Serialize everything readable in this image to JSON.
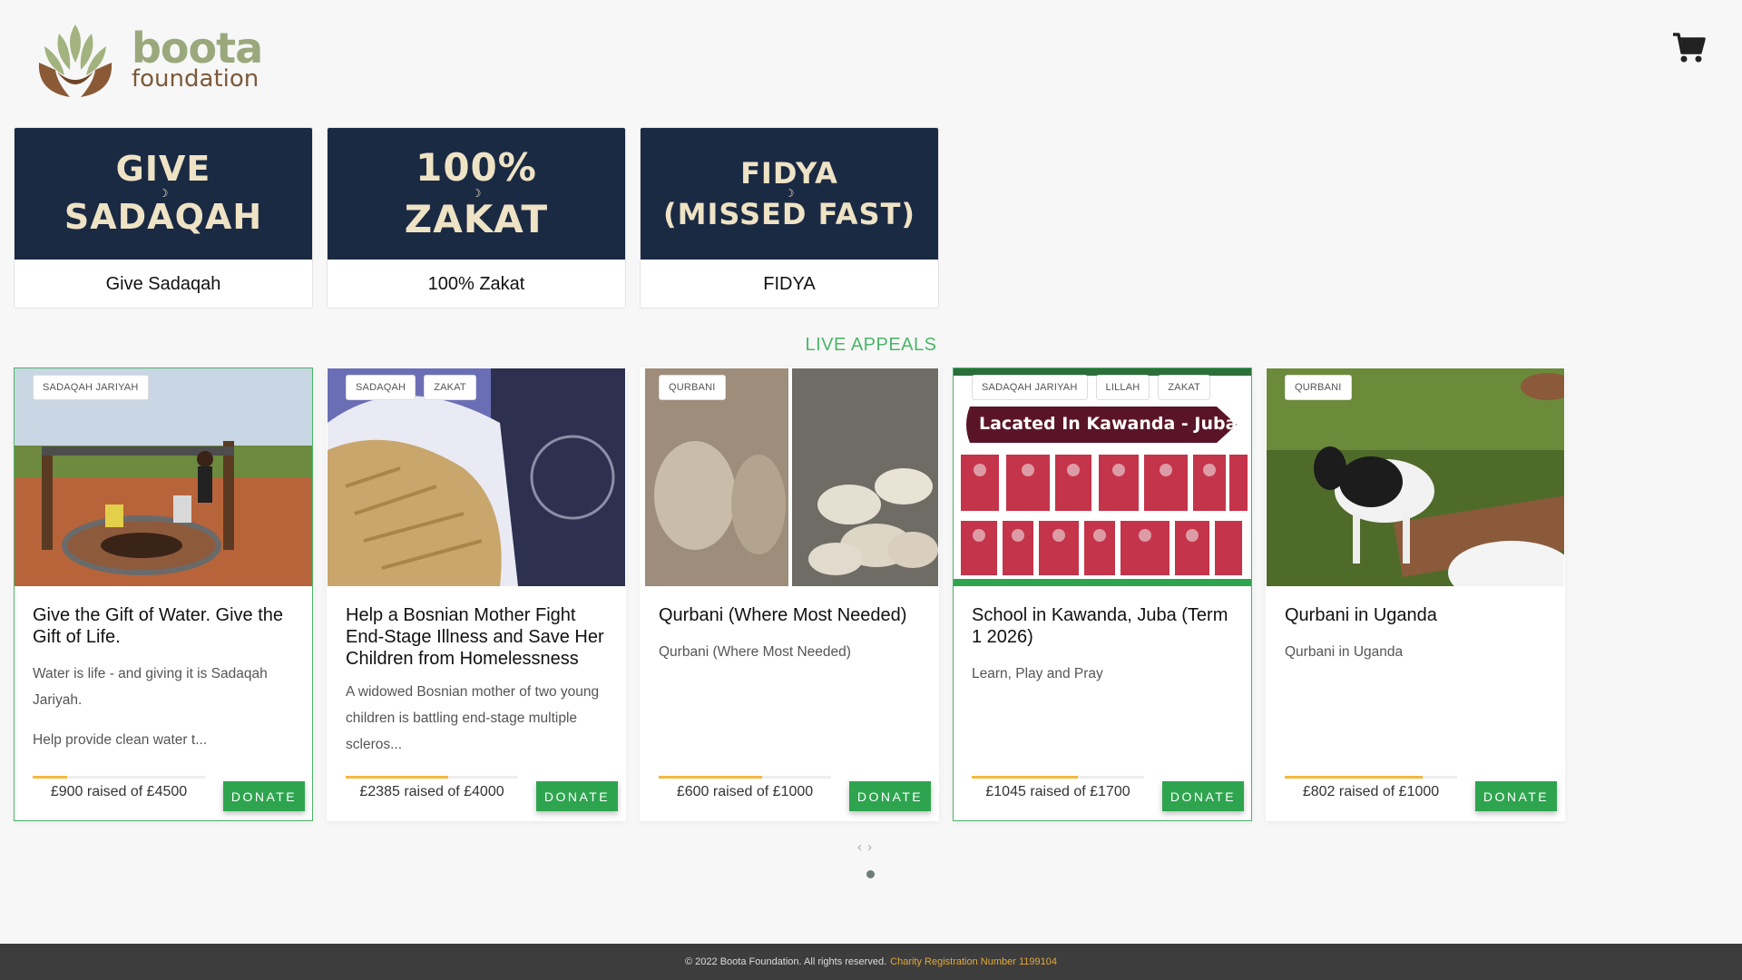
{
  "header": {
    "logo_line1": "boota",
    "logo_line2": "foundation"
  },
  "categories": [
    {
      "image_lines": [
        "GIVE",
        "SADAQAH"
      ],
      "label": "Give Sadaqah"
    },
    {
      "image_lines": [
        "100%",
        "ZAKAT"
      ],
      "label": "100% Zakat"
    },
    {
      "image_lines": [
        "FIDYA",
        "(MISSED FAST)"
      ],
      "label": "FIDYA"
    }
  ],
  "live_appeals_title": "LIVE APPEALS",
  "appeals": [
    {
      "tags": [
        "SADAQAH JARIYAH"
      ],
      "title": "Give the Gift of Water. Give the Gift of Life.",
      "desc1": "Water is life - and giving it is Sadaqah Jariyah.",
      "desc2": "Help provide clean water t...",
      "raised_text": "£900 raised of £4500",
      "progress": 0.2,
      "donate": "DONATE"
    },
    {
      "tags": [
        "SADAQAH",
        "ZAKAT"
      ],
      "title": "Help a Bosnian Mother Fight End-Stage Illness and Save Her Children from Homelessness",
      "desc1": "A widowed Bosnian mother of two young children is battling end-stage multiple scleros...",
      "raised_text": "£2385 raised of £4000",
      "progress": 0.5963,
      "donate": "DONATE"
    },
    {
      "tags": [
        "QURBANI"
      ],
      "title": "Qurbani (Where Most Needed)",
      "desc1": "Qurbani (Where Most Needed)",
      "raised_text": "£600 raised of £1000",
      "progress": 0.6,
      "donate": "DONATE"
    },
    {
      "tags": [
        "SADAQAH JARIYAH",
        "LILLAH",
        "ZAKAT"
      ],
      "image_banner": "Lacated In Kawanda - Juba",
      "title": "School in Kawanda, Juba (Term 1 2026)",
      "desc1": "Learn, Play and Pray",
      "raised_text": "£1045 raised of £1700",
      "progress": 0.6147,
      "donate": "DONATE"
    },
    {
      "tags": [
        "QURBANI"
      ],
      "title": "Qurbani in Uganda",
      "desc1": "Qurbani in Uganda",
      "raised_text": "£802 raised of £1000",
      "progress": 0.802,
      "donate": "DONATE"
    }
  ],
  "carousel": {
    "prev": "‹",
    "next": "›"
  },
  "footer": {
    "copyright": "© 2022 Boota Foundation. All rights reserved.",
    "registration": "Charity Registration Number 1199104"
  },
  "colors": {
    "accent_green": "#2ea44f",
    "progress": "#f4b73f",
    "tile_navy": "#1b2a43",
    "footer_bg": "#3d3d3d"
  }
}
